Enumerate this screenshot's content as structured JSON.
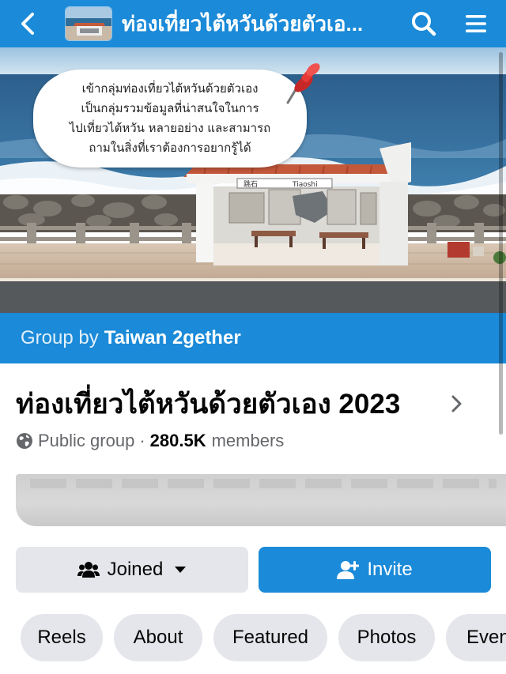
{
  "nav": {
    "title": "ท่องเที่ยวไต้หวันด้วยตัวเอ...",
    "back_icon": "chevron-left-icon",
    "search_icon": "search-icon",
    "menu_icon": "hamburger-menu-icon"
  },
  "cover": {
    "bubble_line1": "เข้ากลุ่มท่องเที่ยวไต้หวันด้วยตัวเอง",
    "bubble_line2": "เป็นกลุ่มรวมข้อมูลที่น่าสนใจในการ",
    "bubble_line3": "ไปเที่ยวไต้หวัน หลายอย่าง และสามารถ",
    "bubble_line4": "ถามในสิ่งที่เราต้องการอยากรู้ได้",
    "sign_cn": "跳石",
    "sign_en": "Tiaoshi"
  },
  "group_by": {
    "prefix": "Group by",
    "owner": "Taiwan 2gether"
  },
  "group": {
    "name": "ท่องเที่ยวไต้หวันด้วยตัวเอง 2023",
    "privacy": "Public group",
    "separator": "·",
    "member_count": "280.5K",
    "members_label": "members"
  },
  "actions": {
    "joined_label": "Joined",
    "invite_label": "Invite"
  },
  "tabs": [
    "Reels",
    "About",
    "Featured",
    "Photos",
    "Events"
  ],
  "colors": {
    "brand_blue": "#1b8ad8",
    "button_gray": "#e4e6eb",
    "text_secondary": "#65676b"
  }
}
